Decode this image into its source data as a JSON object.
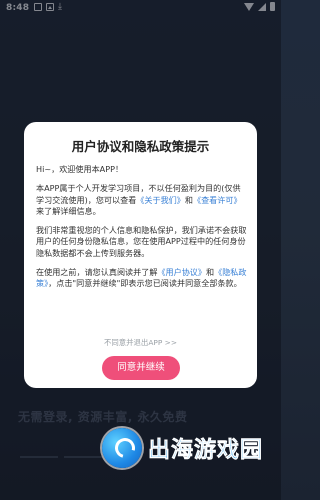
{
  "status_bar": {
    "time": "8:48",
    "left_icons": [
      "square-icon",
      "image-icon",
      "download-icon"
    ],
    "right_icons": [
      "wifi-icon",
      "signal-icon",
      "battery-icon"
    ]
  },
  "background": {
    "tagline": "无需登录, 资源丰富, 永久免费"
  },
  "dialog": {
    "title": "用户协议和隐私政策提示",
    "greeting": "Hi~，欢迎使用本APP！",
    "p1_a": "本APP属于个人开发学习项目，不以任何盈利为目的(仅供学习交流使用)，您可以查看",
    "p1_link1": "《关于我们》",
    "p1_b": "和",
    "p1_link2": "《查看许可》",
    "p1_c": "来了解详细信息。",
    "p2": "我们非常重视您的个人信息和隐私保护，我们承诺不会获取用户的任何身份隐私信息，您在使用APP过程中的任何身份隐私数据都不会上传到服务器。",
    "p3_a": "在使用之前，请您认真阅读并了解",
    "p3_link1": "《用户协议》",
    "p3_b": "和",
    "p3_link2": "《隐私政策》",
    "p3_c": "，点击\"同意并继续\"即表示您已阅读并同意全部条款。",
    "exit_link": "不同意并退出APP >>",
    "agree_button": "同意并继续"
  },
  "watermark": {
    "text": "出海游戏园",
    "logo_color": "#1e88e5"
  },
  "colors": {
    "accent": "#ef4f7a",
    "link": "#3b82d6",
    "background": "#1f2a3c"
  }
}
